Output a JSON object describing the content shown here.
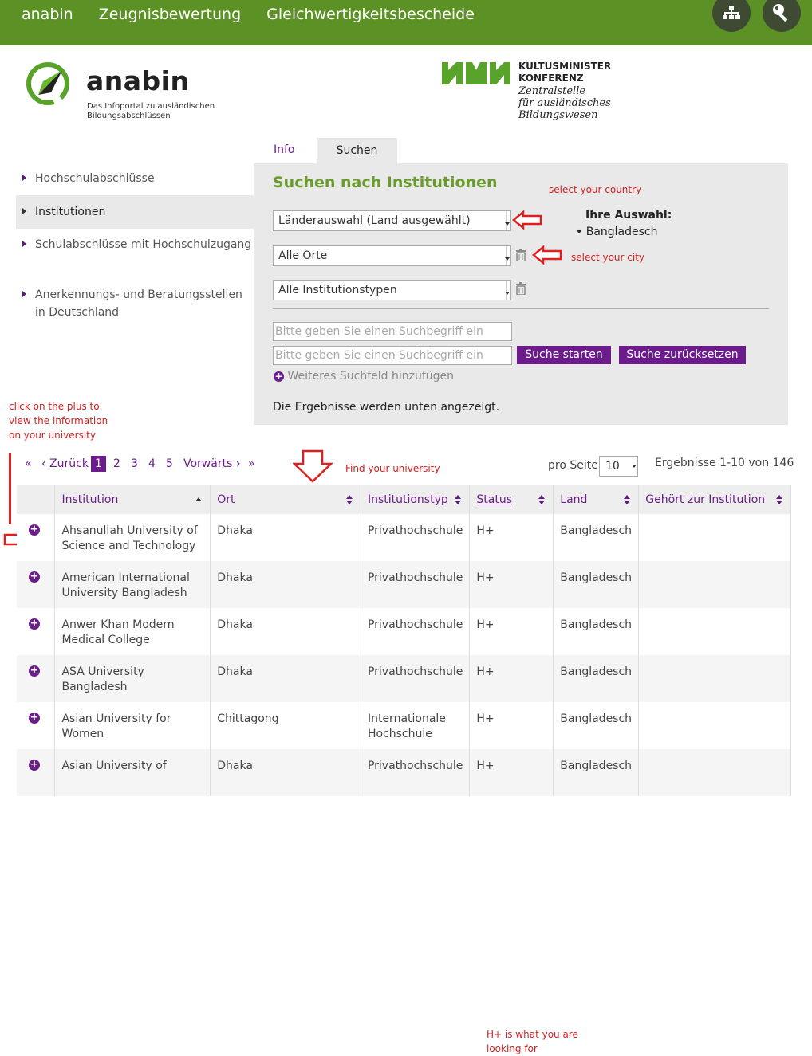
{
  "topnav": {
    "items": [
      "anabin",
      "Zeugnisbewertung",
      "Gleichwertigkeitsbescheide"
    ]
  },
  "logo": {
    "name": "anabin",
    "subtitle": "Das Infoportal zu ausländischen Bildungsabschlüssen"
  },
  "kmk": {
    "line1": "KULTUSMINISTER",
    "line2": "KONFERENZ",
    "sub1": "Zentralstelle",
    "sub2": "für ausländisches",
    "sub3": "Bildungswesen"
  },
  "tabs": {
    "info": "Info",
    "suchen": "Suchen"
  },
  "sidebar": {
    "items": [
      {
        "label": "Hochschulabschlüsse"
      },
      {
        "label": "Institutionen"
      },
      {
        "label": "Schulabschlüsse mit Hochschulzugang"
      },
      {
        "label": "Anerkennungs- und Beratungsstellen in Deutschland"
      }
    ]
  },
  "search": {
    "title": "Suchen nach Institutionen",
    "country_select": "Länderauswahl (Land ausgewählt)",
    "city_select": "Alle Orte",
    "type_select": "Alle Institutionstypen",
    "selection_title": "Ihre Auswahl:",
    "selection_item": "Bangladesch",
    "placeholder": "Bitte geben Sie einen Suchbegriff ein",
    "start_button": "Suche starten",
    "reset_button": "Suche zurücksetzen",
    "add_field": "Weiteres Suchfeld hinzufügen",
    "results_note": "Die Ergebnisse werden unten angezeigt."
  },
  "annotations": {
    "country": "select your country",
    "city": "select your city",
    "plus_note": "click on the plus to view the information on your university",
    "find": "Find your university",
    "status_note": "H+ is what you are looking for"
  },
  "pager": {
    "first": "«",
    "prev": "‹ Zurück",
    "pages": [
      "1",
      "2",
      "3",
      "4",
      "5"
    ],
    "next": "Vorwärts ›",
    "last": "»",
    "per_page_label": "pro Seite",
    "per_page_value": "10",
    "results": "Ergebnisse 1-10 von 146"
  },
  "table": {
    "headers": [
      "Institution",
      "Ort",
      "Institutionstyp",
      "Status",
      "Land",
      "Gehört zur Institution"
    ],
    "rows": [
      {
        "institution": "Ahsanullah University of Science and Technology",
        "ort": "Dhaka",
        "typ": "Privathochschule",
        "status": "H+",
        "land": "Bangladesch"
      },
      {
        "institution": "American International University Bangladesh",
        "ort": "Dhaka",
        "typ": "Privathochschule",
        "status": "H+",
        "land": "Bangladesch"
      },
      {
        "institution": "Anwer Khan Modern Medical College",
        "ort": "Dhaka",
        "typ": "Privathochschule",
        "status": "H+",
        "land": "Bangladesch"
      },
      {
        "institution": "ASA University Bangladesh",
        "ort": "Dhaka",
        "typ": "Privathochschule",
        "status": "H+",
        "land": "Bangladesch"
      },
      {
        "institution": "Asian University for Women",
        "ort": "Chittagong",
        "typ": "Internationale Hochschule",
        "status": "H+",
        "land": "Bangladesch"
      },
      {
        "institution": "Asian University of",
        "ort": "Dhaka",
        "typ": "Privathochschule",
        "status": "H+",
        "land": "Bangladesch"
      }
    ]
  },
  "colors": {
    "green": "#5b9125",
    "purple": "#6a1c8a",
    "red": "#d32020"
  }
}
